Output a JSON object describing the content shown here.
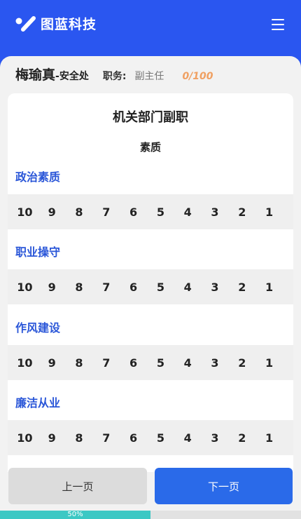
{
  "header": {
    "brand": "图蓝科技",
    "logo_icon": "brand-logo-icon",
    "menu_icon": "hamburger-menu-icon"
  },
  "user": {
    "name": "梅瑜真",
    "dept": "-安全处",
    "position_label": "职务:",
    "position_value": "副主任",
    "progress_count": "0/100"
  },
  "card": {
    "title": "机关部门副职",
    "subtitle": "素质",
    "sections": [
      {
        "title": "政治素质",
        "scores": [
          "10",
          "9",
          "8",
          "7",
          "6",
          "5",
          "4",
          "3",
          "2",
          "1"
        ]
      },
      {
        "title": "职业操守",
        "scores": [
          "10",
          "9",
          "8",
          "7",
          "6",
          "5",
          "4",
          "3",
          "2",
          "1"
        ]
      },
      {
        "title": "作风建设",
        "scores": [
          "10",
          "9",
          "8",
          "7",
          "6",
          "5",
          "4",
          "3",
          "2",
          "1"
        ]
      },
      {
        "title": "廉洁从业",
        "scores": [
          "10",
          "9",
          "8",
          "7",
          "6",
          "5",
          "4",
          "3",
          "2",
          "1"
        ]
      }
    ]
  },
  "nav": {
    "prev_label": "上一页",
    "next_label": "下一页"
  },
  "progress": {
    "label": "50%",
    "fraction": 0.5
  },
  "colors": {
    "brand_blue": "#2a56f0",
    "section_title": "#2a56d8",
    "next_button": "#2a6ae9",
    "progress_fill": "#3cc8c4",
    "progress_count": "#f0a062"
  }
}
